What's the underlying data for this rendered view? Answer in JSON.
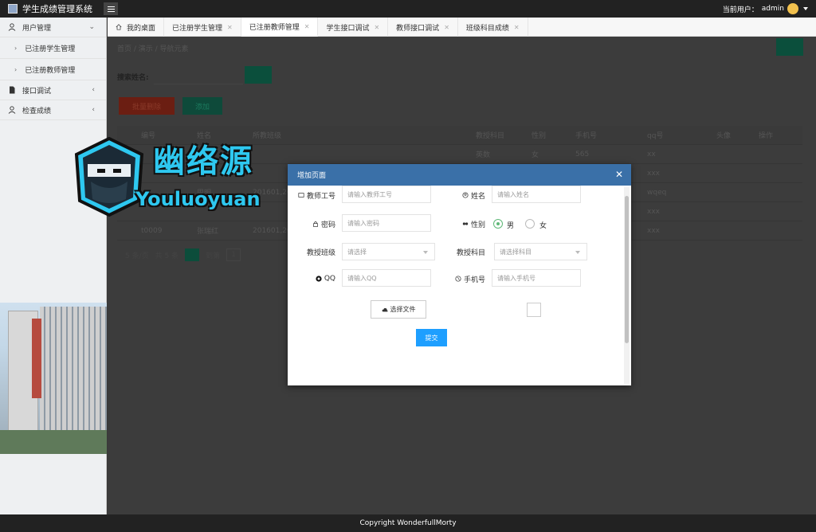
{
  "header": {
    "app_title": "学生成绩管理系统",
    "current_user_label": "当前用户：",
    "current_user": "admin"
  },
  "sidebar": {
    "items": [
      {
        "label": "用户管理",
        "icon": "user-icon",
        "expanded": true
      },
      {
        "label": "已注册学生管理",
        "sub": true
      },
      {
        "label": "已注册教师管理",
        "sub": true
      },
      {
        "label": "接口调试",
        "icon": "document-icon"
      },
      {
        "label": "检查成绩",
        "icon": "user-icon"
      }
    ]
  },
  "tabs": [
    {
      "label": "我的桌面",
      "icon": "home-icon",
      "closable": false
    },
    {
      "label": "已注册学生管理",
      "closable": true
    },
    {
      "label": "已注册教师管理",
      "closable": true,
      "active": true
    },
    {
      "label": "学生接口调试",
      "closable": true
    },
    {
      "label": "教师接口调试",
      "closable": true
    },
    {
      "label": "班级科目成绩",
      "closable": true
    }
  ],
  "main": {
    "breadcrumb": "首页  /  演示  /  导航元素",
    "search_label": "搜索姓名:",
    "batch_delete_label": "批量删除",
    "add_label": "添加",
    "table": {
      "columns": [
        "编号",
        "姓名",
        "所教班级",
        "教授科目",
        "性别",
        "手机号",
        "qq号",
        "头像",
        "操作"
      ],
      "rows": [
        {
          "subject": "英数",
          "gender": "女",
          "phone": "565",
          "qq": "xx"
        },
        {
          "qq": "xxx"
        },
        {
          "name": "周明",
          "cls": "201601,201",
          "qq": "wqeq"
        },
        {
          "qq": "xxx"
        },
        {
          "id": "t0009",
          "name": "张瑞红",
          "cls": "201601,201",
          "qq": "xxx"
        }
      ]
    },
    "pager": {
      "page_size": "5 条/页",
      "total": "共 5 条",
      "current_page": "1",
      "goto_label": "到第",
      "goto_value": "1"
    }
  },
  "watermark": {
    "cn": "幽络源",
    "en": "Youluoyuan"
  },
  "modal": {
    "title": "增加页面",
    "fields": {
      "teacher_id": {
        "label": "教师工号",
        "placeholder": "请输入教师工号"
      },
      "name": {
        "label": "姓名",
        "placeholder": "请输入姓名"
      },
      "password": {
        "label": "密码",
        "placeholder": "请输入密码"
      },
      "gender": {
        "label": "性别",
        "options": [
          "男",
          "女"
        ],
        "selected": "男"
      },
      "class": {
        "label": "教授班级",
        "placeholder": "请选择"
      },
      "subject": {
        "label": "教授科目",
        "placeholder": "请选择科目"
      },
      "qq": {
        "label": "QQ",
        "placeholder": "请输入QQ"
      },
      "phone": {
        "label": "手机号",
        "placeholder": "请输入手机号"
      }
    },
    "file_button": "选择文件",
    "submit_button": "提交"
  },
  "footer": {
    "copyright": "Copyright WonderfullMorty"
  },
  "colors": {
    "header_bg": "#222222",
    "modal_header": "#3a70a8",
    "submit_blue": "#1e9fff",
    "radio_green": "#5fb878"
  }
}
